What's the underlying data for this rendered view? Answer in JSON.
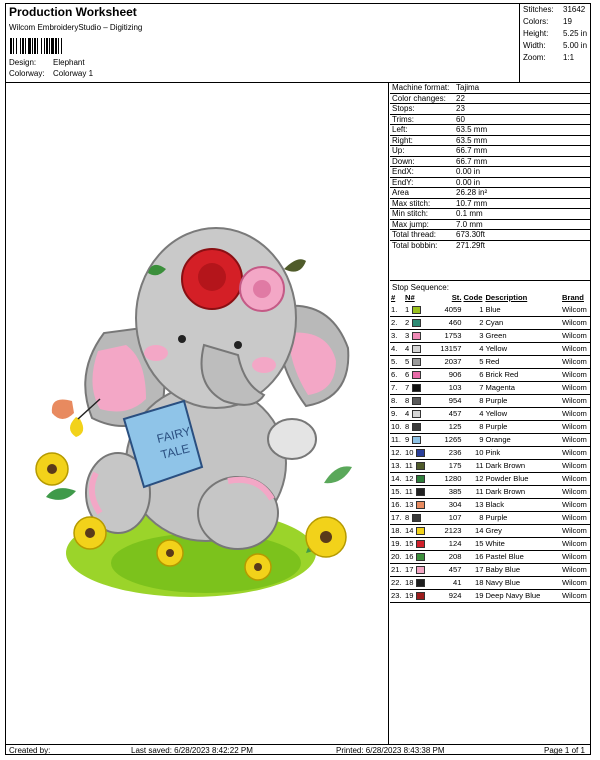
{
  "header": {
    "title": "Production Worksheet",
    "subtitle": "Wilcom EmbroideryStudio – Digitizing",
    "design_label": "Design:",
    "design_value": "Elephant",
    "colorway_label": "Colorway:",
    "colorway_value": "Colorway 1"
  },
  "summary": [
    {
      "label": "Stitches:",
      "value": "31642"
    },
    {
      "label": "Colors:",
      "value": "19"
    },
    {
      "label": "Height:",
      "value": "5.25 in"
    },
    {
      "label": "Width:",
      "value": "5.00 in"
    },
    {
      "label": "Zoom:",
      "value": "1:1"
    }
  ],
  "stats": [
    {
      "label": "Machine format:",
      "value": "Tajima"
    },
    {
      "label": "Color changes:",
      "value": "22"
    },
    {
      "label": "Stops:",
      "value": "23"
    },
    {
      "label": "Trims:",
      "value": "60"
    },
    {
      "label": "Left:",
      "value": "63.5 mm"
    },
    {
      "label": "Right:",
      "value": "63.5 mm"
    },
    {
      "label": "Up:",
      "value": "66.7 mm"
    },
    {
      "label": "Down:",
      "value": "66.7 mm"
    },
    {
      "label": "EndX:",
      "value": "0.00 in"
    },
    {
      "label": "EndY:",
      "value": "0.00 in"
    },
    {
      "label": "Area",
      "value": "26.28 in²"
    },
    {
      "label": "Max stitch:",
      "value": "10.7 mm"
    },
    {
      "label": "Min stitch:",
      "value": "0.1 mm"
    },
    {
      "label": "Max jump:",
      "value": "7.0 mm"
    },
    {
      "label": "Total thread:",
      "value": "673.30ft"
    },
    {
      "label": "Total bobbin:",
      "value": "271.29ft"
    }
  ],
  "sequence": {
    "title": "Stop Sequence:",
    "columns": [
      "#",
      "N#",
      "St.",
      "Code",
      "Description",
      "Brand"
    ],
    "rows": [
      {
        "n": "1.",
        "needle": "1",
        "color": "#9bc21f",
        "st": "4059",
        "code": "1",
        "desc": "Blue",
        "brand": "Wilcom"
      },
      {
        "n": "2.",
        "needle": "2",
        "color": "#2d8b74",
        "st": "460",
        "code": "2",
        "desc": "Cyan",
        "brand": "Wilcom"
      },
      {
        "n": "3.",
        "needle": "3",
        "color": "#f08ab6",
        "st": "1753",
        "code": "3",
        "desc": "Green",
        "brand": "Wilcom"
      },
      {
        "n": "4.",
        "needle": "4",
        "color": "#d6d6d6",
        "st": "13157",
        "code": "4",
        "desc": "Yellow",
        "brand": "Wilcom"
      },
      {
        "n": "5.",
        "needle": "5",
        "color": "#9a9a9a",
        "st": "2037",
        "code": "5",
        "desc": "Red",
        "brand": "Wilcom"
      },
      {
        "n": "6.",
        "needle": "6",
        "color": "#e86aa8",
        "st": "906",
        "code": "6",
        "desc": "Brick Red",
        "brand": "Wilcom"
      },
      {
        "n": "7.",
        "needle": "7",
        "color": "#111111",
        "st": "103",
        "code": "7",
        "desc": "Magenta",
        "brand": "Wilcom"
      },
      {
        "n": "8.",
        "needle": "8",
        "color": "#5a5a5a",
        "st": "954",
        "code": "8",
        "desc": "Purple",
        "brand": "Wilcom"
      },
      {
        "n": "9.",
        "needle": "4",
        "color": "#d6d6d6",
        "st": "457",
        "code": "4",
        "desc": "Yellow",
        "brand": "Wilcom"
      },
      {
        "n": "10.",
        "needle": "8",
        "color": "#3a3a3a",
        "st": "125",
        "code": "8",
        "desc": "Purple",
        "brand": "Wilcom"
      },
      {
        "n": "11.",
        "needle": "9",
        "color": "#8ec3e6",
        "st": "1265",
        "code": "9",
        "desc": "Orange",
        "brand": "Wilcom"
      },
      {
        "n": "12.",
        "needle": "10",
        "color": "#2a3f9a",
        "st": "236",
        "code": "10",
        "desc": "Pink",
        "brand": "Wilcom"
      },
      {
        "n": "13.",
        "needle": "11",
        "color": "#4f5b2a",
        "st": "175",
        "code": "11",
        "desc": "Dark Brown",
        "brand": "Wilcom"
      },
      {
        "n": "14.",
        "needle": "12",
        "color": "#2e7d3a",
        "st": "1280",
        "code": "12",
        "desc": "Powder Blue",
        "brand": "Wilcom"
      },
      {
        "n": "15.",
        "needle": "11",
        "color": "#222222",
        "st": "385",
        "code": "11",
        "desc": "Dark Brown",
        "brand": "Wilcom"
      },
      {
        "n": "16.",
        "needle": "13",
        "color": "#e88a5f",
        "st": "304",
        "code": "13",
        "desc": "Black",
        "brand": "Wilcom"
      },
      {
        "n": "17.",
        "needle": "8",
        "color": "#3a3a3a",
        "st": "107",
        "code": "8",
        "desc": "Purple",
        "brand": "Wilcom"
      },
      {
        "n": "18.",
        "needle": "14",
        "color": "#f2d21a",
        "st": "2123",
        "code": "14",
        "desc": "Grey",
        "brand": "Wilcom"
      },
      {
        "n": "19.",
        "needle": "15",
        "color": "#d11f2a",
        "st": "124",
        "code": "15",
        "desc": "White",
        "brand": "Wilcom"
      },
      {
        "n": "20.",
        "needle": "16",
        "color": "#3b8f3b",
        "st": "208",
        "code": "16",
        "desc": "Pastel Blue",
        "brand": "Wilcom"
      },
      {
        "n": "21.",
        "needle": "17",
        "color": "#f4a7c4",
        "st": "457",
        "code": "17",
        "desc": "Baby Blue",
        "brand": "Wilcom"
      },
      {
        "n": "22.",
        "needle": "18",
        "color": "#1e1e1e",
        "st": "41",
        "code": "18",
        "desc": "Navy Blue",
        "brand": "Wilcom"
      },
      {
        "n": "23.",
        "needle": "19",
        "color": "#9c1c1c",
        "st": "924",
        "code": "19",
        "desc": "Deep Navy Blue",
        "brand": "Wilcom"
      }
    ]
  },
  "book_text": {
    "line1": "FAIRY",
    "line2": "TALE"
  },
  "footer": {
    "created": "Created by:",
    "last_saved": "Last saved: 6/28/2023 8:42:22 PM",
    "printed": "Printed: 6/28/2023 8:43:38 PM",
    "page": "Page 1 of 1"
  }
}
